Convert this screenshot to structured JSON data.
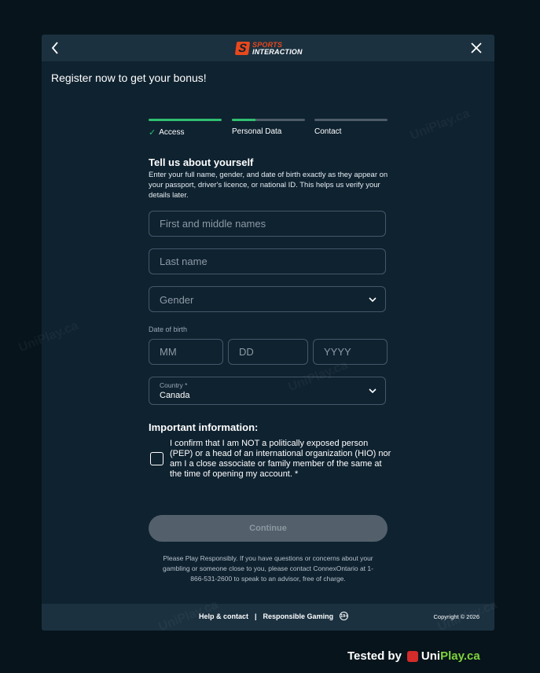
{
  "header": {
    "logo_line1": "SPORTS",
    "logo_line2": "INTERACTION",
    "logo_mark": "S",
    "back_icon": "chevron-left-icon",
    "close_icon": "close-icon"
  },
  "bonus_text": "Register now to get your bonus!",
  "stepper": {
    "steps": [
      {
        "label": "Access",
        "progress": 1.0,
        "completed": true
      },
      {
        "label": "Personal Data",
        "progress": 0.32,
        "completed": false
      },
      {
        "label": "Contact",
        "progress": 0,
        "completed": false
      }
    ]
  },
  "section": {
    "title": "Tell us about yourself",
    "description": "Enter your full name, gender, and date of birth exactly as they appear on your passport, driver's licence, or national ID. This helps us verify your details later."
  },
  "form": {
    "first_name_placeholder": "First and middle names",
    "last_name_placeholder": "Last name",
    "gender_placeholder": "Gender",
    "dob_label": "Date of birth",
    "dob_mm": "MM",
    "dob_dd": "DD",
    "dob_yyyy": "YYYY",
    "country_label": "Country *",
    "country_value": "Canada"
  },
  "important": {
    "title": "Important information:",
    "confirm_text": "I confirm that I am NOT a politically exposed person (PEP) or a head of an international organization (HIO) nor am I a close associate or family member of the same at the time of opening my account. *"
  },
  "continue_label": "Continue",
  "disclaimer": "Please Play Responsibly. If you have questions or concerns about your gambling or someone close to you, please contact ConnexOntario at 1-866-531-2600 to speak to an advisor, free of charge.",
  "footer": {
    "help_label": "Help & contact",
    "separator": "|",
    "responsible_label": "Responsible Gaming",
    "age_badge": "19+",
    "copyright": "Copyright © 2026"
  },
  "watermark": "UniPlay.ca",
  "tested_by": {
    "prefix": "Tested by",
    "brand_uni": "Uni",
    "brand_play": "Play.ca"
  },
  "colors": {
    "accent_green": "#2fbf71",
    "brand_orange": "#e8481c",
    "modal_bg": "#0f2230",
    "page_bg": "#07141b"
  }
}
